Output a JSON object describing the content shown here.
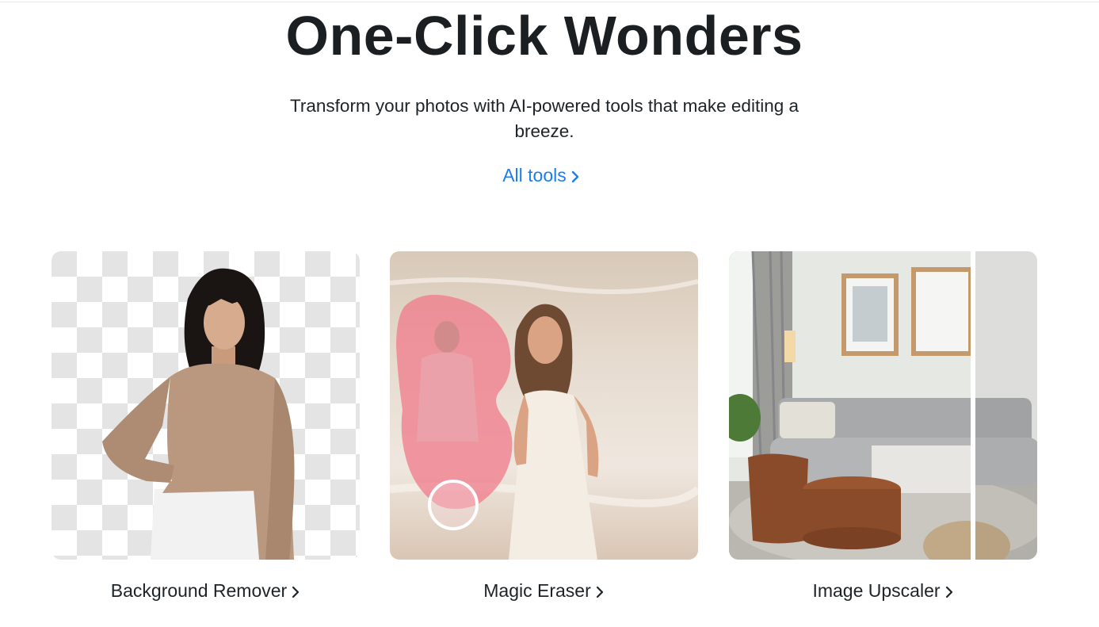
{
  "hero": {
    "title": "One-Click Wonders",
    "subtitle": "Transform your photos with AI-powered tools that make editing a breeze.",
    "all_tools_label": "All tools"
  },
  "tools": [
    {
      "label": "Background Remover",
      "icon": "chevron-right-icon"
    },
    {
      "label": "Magic Eraser",
      "icon": "chevron-right-icon"
    },
    {
      "label": "Image Upscaler",
      "icon": "chevron-right-icon"
    }
  ],
  "colors": {
    "link": "#1a7df0",
    "text": "#1d2327",
    "eraser_overlay": "#f07a8a"
  }
}
